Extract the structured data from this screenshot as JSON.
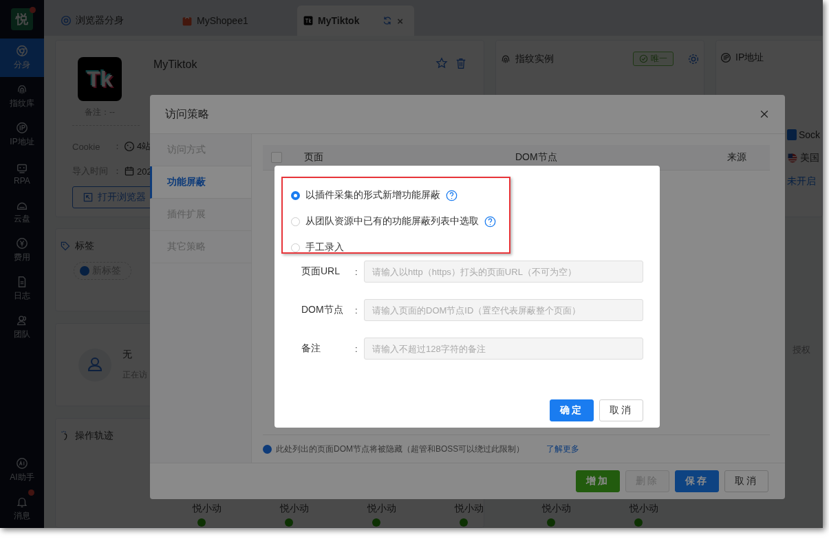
{
  "sidebar": {
    "logo": "悦",
    "logo_badge": true,
    "items": [
      {
        "label": "分身",
        "selected": true
      },
      {
        "label": "指纹库",
        "selected": false
      },
      {
        "label": "IP地址",
        "selected": false
      },
      {
        "label": "RPA",
        "selected": false
      },
      {
        "label": "云盘",
        "selected": false
      },
      {
        "label": "费用",
        "selected": false
      },
      {
        "label": "日志",
        "selected": false
      },
      {
        "label": "团队",
        "selected": false
      }
    ],
    "bottom_items": [
      {
        "label": "AI助手",
        "badge": false
      },
      {
        "label": "消息",
        "badge": true
      }
    ]
  },
  "tabs": [
    {
      "label": "浏览器分身",
      "selected": false,
      "kind": "browser"
    },
    {
      "label": "MyShopee1",
      "selected": false,
      "kind": "shop"
    },
    {
      "label": "MyTiktok",
      "selected": true,
      "kind": "app",
      "close": "×"
    }
  ],
  "profile": {
    "avatar_text": "Tk",
    "name": "MyTiktok",
    "note": "备注：--",
    "colon": "：",
    "rows": [
      {
        "label": "Cookie",
        "value": "4站",
        "kind": "cookie"
      },
      {
        "label": "导入时间",
        "value": "202",
        "kind": "date"
      }
    ],
    "open_button": "打开浏览器"
  },
  "fingerprint": {
    "title": "指纹实例",
    "badge": "唯一"
  },
  "ip": {
    "title": "IP地址",
    "proxy": "Sock",
    "country": "美国",
    "status": "未开启"
  },
  "tags": {
    "title": "标签",
    "add_button": "新标签"
  },
  "visitor": {
    "name": "无",
    "status": "正在访"
  },
  "auth": {
    "label": "授权"
  },
  "trail": {
    "title": "操作轨迹",
    "actors": [
      "悦小动",
      "悦小动",
      "悦小动",
      "悦小动",
      "悦小动",
      "悦小动"
    ]
  },
  "policy_dialog": {
    "title": "访问策略",
    "menu": [
      {
        "label": "访问方式",
        "selected": false
      },
      {
        "label": "功能屏蔽",
        "selected": true
      },
      {
        "label": "插件扩展",
        "selected": false
      },
      {
        "label": "其它策略",
        "selected": false
      }
    ],
    "columns": [
      "页面",
      "DOM节点",
      "来源"
    ],
    "select_all_checked": false,
    "note": "此处列出的页面DOM节点将被隐藏（超管和BOSS可以绕过此限制）",
    "note_link": "了解更多",
    "buttons": [
      {
        "label": "增加",
        "kind": "success",
        "disabled": false
      },
      {
        "label": "删除",
        "kind": "default",
        "disabled": true
      },
      {
        "label": "保存",
        "kind": "primary",
        "disabled": false
      },
      {
        "label": "取消",
        "kind": "default",
        "disabled": false
      }
    ]
  },
  "add_dialog": {
    "options": [
      {
        "label": "以插件采集的形式新增功能屏蔽",
        "selected": true,
        "help": true
      },
      {
        "label": "从团队资源中已有的功能屏蔽列表中选取",
        "selected": false,
        "help": true
      },
      {
        "label": "手工录入",
        "selected": false,
        "help": false
      }
    ],
    "colon": ":",
    "fields": [
      {
        "label": "页面URL",
        "placeholder": "请输入以http（https）打头的页面URL（不可为空）"
      },
      {
        "label": "DOM节点",
        "placeholder": "请输入页面的DOM节点ID（置空代表屏蔽整个页面）"
      },
      {
        "label": "备注",
        "placeholder": "请输入不超过128字符的备注"
      }
    ],
    "buttons": [
      {
        "label": "确定",
        "kind": "primary",
        "disabled": false
      },
      {
        "label": "取消",
        "kind": "default",
        "disabled": false
      }
    ]
  }
}
